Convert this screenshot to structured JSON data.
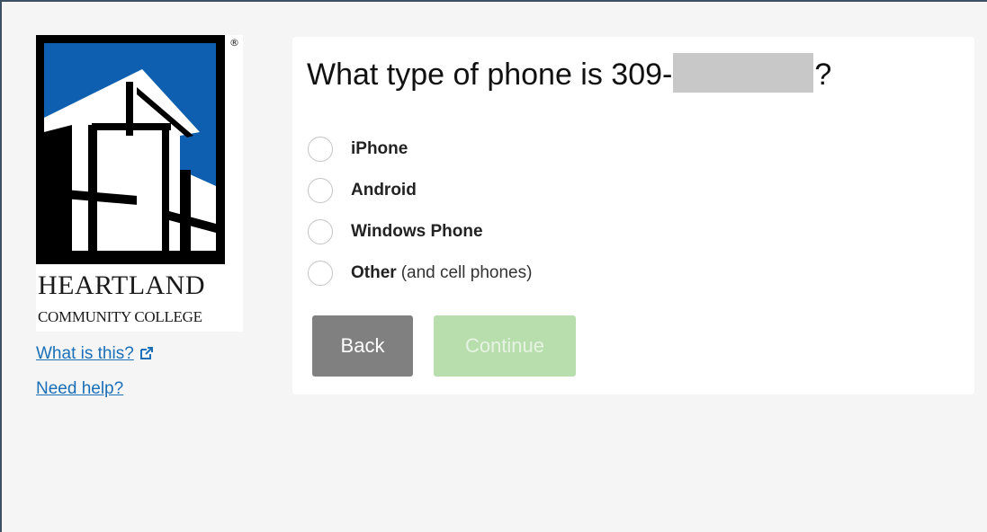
{
  "logo": {
    "name": "HEARTLAND",
    "subtitle": "COMMUNITY COLLEGE",
    "registered_mark": "®",
    "colors": {
      "blue": "#0f5fb0",
      "black": "#000000",
      "white": "#ffffff"
    }
  },
  "side_links": {
    "what_is_this": "What is this?",
    "what_is_this_icon": "external-link-icon",
    "need_help": "Need help?"
  },
  "question": {
    "prefix": "What type of phone is 309-",
    "suffix": "?"
  },
  "options": [
    {
      "label": "iPhone",
      "note": ""
    },
    {
      "label": "Android",
      "note": ""
    },
    {
      "label": "Windows Phone",
      "note": ""
    },
    {
      "label": "Other",
      "note": "(and cell phones)"
    }
  ],
  "buttons": {
    "back": "Back",
    "continue": "Continue",
    "continue_enabled": false
  },
  "colors": {
    "link": "#1a6fb8",
    "back_button": "#808080",
    "continue_button_disabled": "#b7deac",
    "page_background": "#f5f5f5",
    "frame_border": "#3d4f63"
  }
}
